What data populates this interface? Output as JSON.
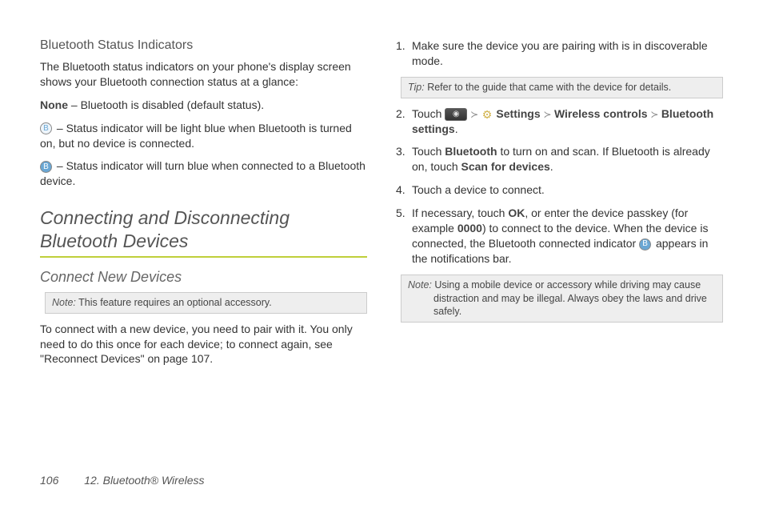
{
  "left": {
    "subsection": "Bluetooth Status Indicators",
    "intro": "The Bluetooth status indicators on your phone's display screen shows your Bluetooth connection status at a glance:",
    "none_label": "None",
    "none_desc": "  – Bluetooth is disabled (default status).",
    "light_desc": " – Status indicator will be light blue when Bluetooth is turned on, but no device is connected.",
    "on_desc": " – Status indicator will turn blue when connected to a Bluetooth device.",
    "section_title": "Connecting and Disconnecting Bluetooth Devices",
    "subheading": "Connect New Devices",
    "note_label": "Note:",
    "note_text": " This feature requires an optional accessory.",
    "pair_text": "To connect with a new device, you need to pair with it. You only need to do this once for each device; to connect again, see \"Reconnect Devices\" on page 107."
  },
  "right": {
    "step1": "Make sure the device you are pairing with is in discoverable mode.",
    "tip_label": "Tip:",
    "tip_text": "  Refer to the guide that came with the device for details.",
    "step2_touch": "Touch ",
    "step2_settings": " Settings",
    "step2_wireless": "Wireless controls",
    "step2_bluetooth": "Bluetooth settings",
    "step3_a": "Touch ",
    "step3_bt": "Bluetooth",
    "step3_b": " to turn on and scan. If Bluetooth is already on, touch ",
    "step3_scan": "Scan for devices",
    "step4": "Touch a device to connect.",
    "step5_a": "If necessary, touch ",
    "step5_ok": "OK",
    "step5_b": ", or enter the device passkey (for example ",
    "step5_0000": "0000",
    "step5_c": ") to connect to the device. When the device is connected, the Bluetooth connected indicator ",
    "step5_d": " appears in the notifications bar.",
    "note2_label": "Note:",
    "note2_text": "  Using a mobile device or accessory while driving may cause distraction and may be illegal. Always obey the laws and drive safely."
  },
  "footer": {
    "page": "106",
    "chapter": "12. Bluetooth® Wireless"
  }
}
